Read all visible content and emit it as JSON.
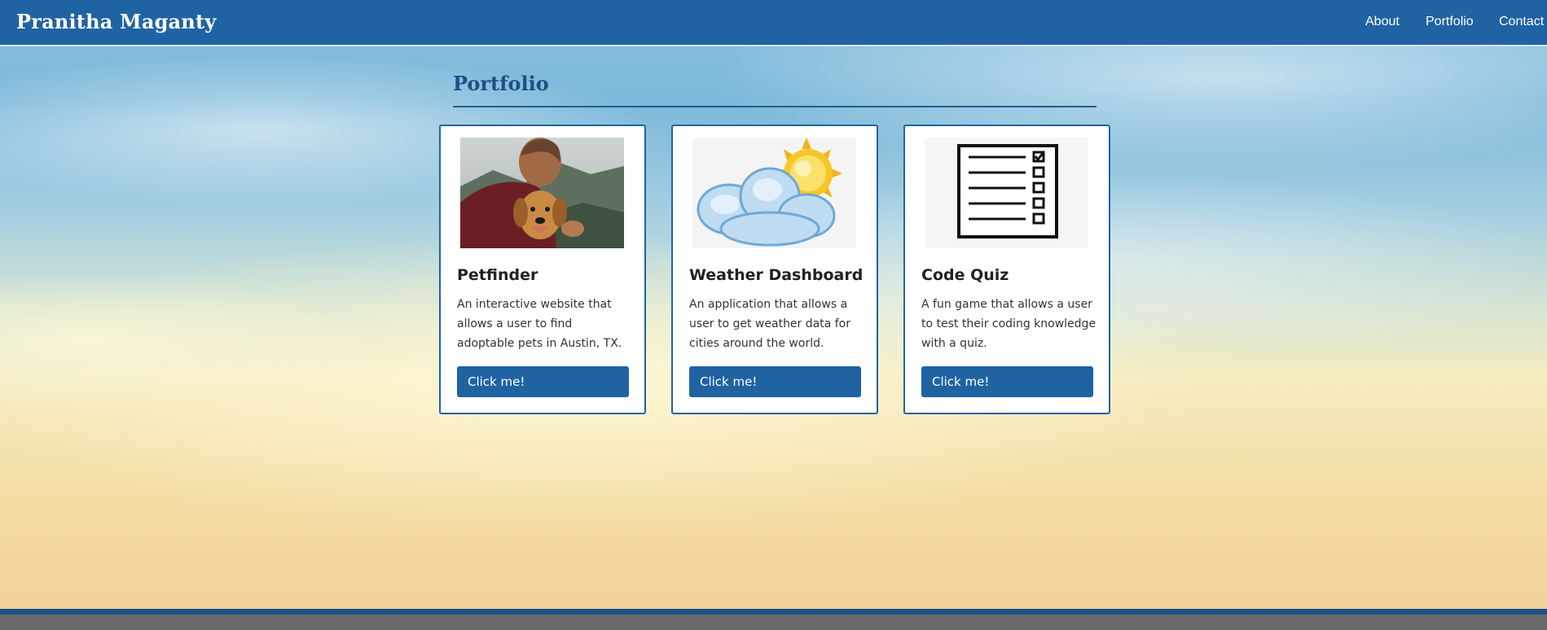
{
  "header": {
    "brand": "Pranitha Maganty",
    "nav": [
      "About",
      "Portfolio",
      "Contact"
    ]
  },
  "portfolio": {
    "title": "Portfolio",
    "cards": [
      {
        "image": "man-hugging-dog-photo",
        "title": "Petfinder",
        "description": "An interactive website that allows a user to find adoptable pets in Austin, TX.",
        "button": "Click me!"
      },
      {
        "image": "sun-behind-cloud-icon",
        "title": "Weather Dashboard",
        "description": "An application that allows a user to get weather data for cities around the world.",
        "button": "Click me!"
      },
      {
        "image": "checklist-icon",
        "title": "Code Quiz",
        "description": "A fun game that allows a user to test their coding knowledge with a quiz.",
        "button": "Click me!"
      }
    ]
  },
  "colors": {
    "primary": "#2063a3",
    "title": "#1f4f86",
    "footer": "#6a6a6a"
  }
}
